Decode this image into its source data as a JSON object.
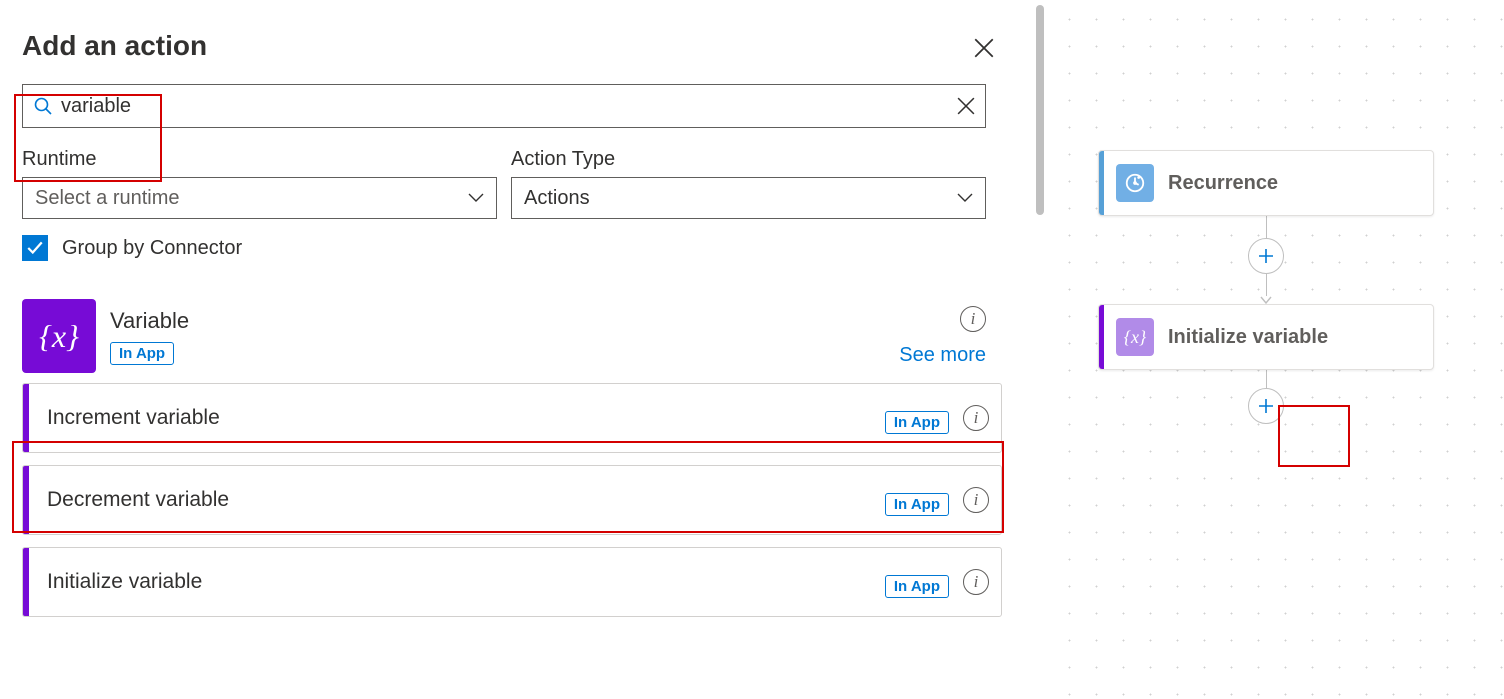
{
  "panel": {
    "title": "Add an action",
    "search": {
      "value": "variable"
    },
    "filters": {
      "runtime_label": "Runtime",
      "runtime_placeholder": "Select a runtime",
      "action_type_label": "Action Type",
      "action_type_value": "Actions"
    },
    "group_by_connector_label": "Group by Connector",
    "connector": {
      "title": "Variable",
      "badge": "In App",
      "see_more": "See more"
    },
    "actions": [
      {
        "label": "Increment variable",
        "badge": "In App"
      },
      {
        "label": "Decrement variable",
        "badge": "In App"
      },
      {
        "label": "Initialize variable",
        "badge": "In App"
      }
    ]
  },
  "canvas": {
    "cards": {
      "recurrence": "Recurrence",
      "initialize_variable": "Initialize variable"
    }
  }
}
